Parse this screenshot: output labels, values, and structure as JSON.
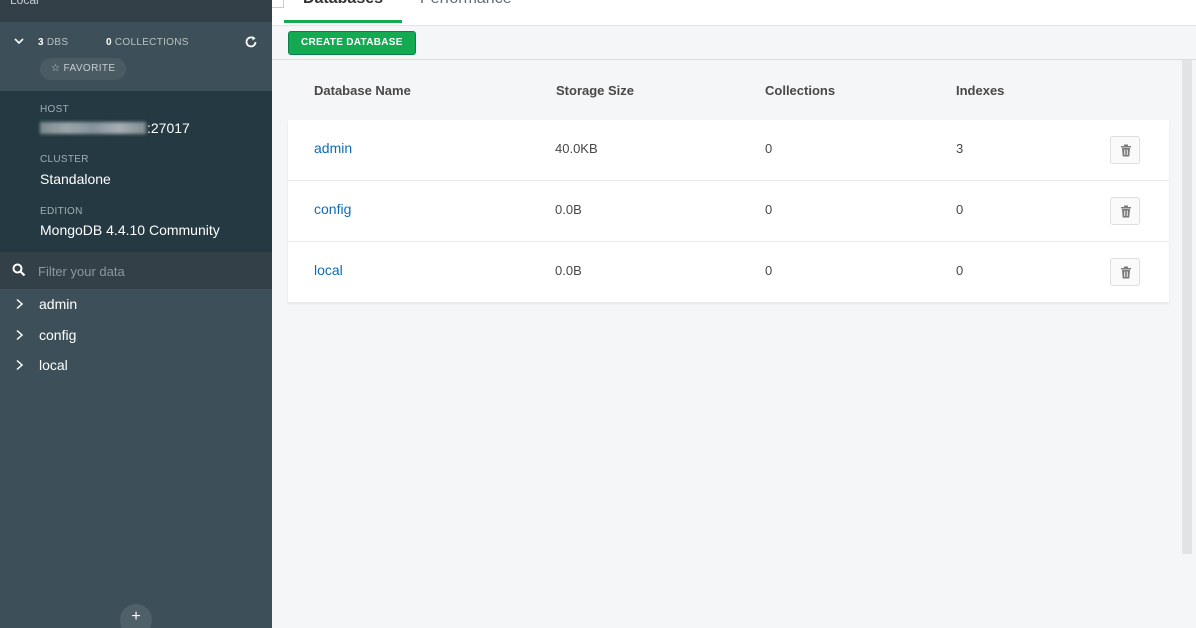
{
  "app": {
    "title": "Local"
  },
  "sidebar": {
    "stats": {
      "dbs_count": "3",
      "dbs_label": "DBS",
      "collections_count": "0",
      "collections_label": "COLLECTIONS"
    },
    "favorite_label": "☆ FAVORITE",
    "host_label": "HOST",
    "host_port": ":27017",
    "cluster_label": "CLUSTER",
    "cluster_value": "Standalone",
    "edition_label": "EDITION",
    "edition_value": "MongoDB 4.4.10 Community",
    "filter_placeholder": "Filter your data",
    "databases": [
      {
        "label": "admin"
      },
      {
        "label": "config"
      },
      {
        "label": "local"
      }
    ],
    "add_label": "+"
  },
  "tabs": [
    {
      "label": "Databases"
    },
    {
      "label": "Performance"
    }
  ],
  "toolbar": {
    "create_label": "CREATE DATABASE"
  },
  "table": {
    "columns": [
      "Database Name",
      "Storage Size",
      "Collections",
      "Indexes"
    ],
    "rows": [
      {
        "name": "admin",
        "storage": "40.0KB",
        "collections": "0",
        "indexes": "3"
      },
      {
        "name": "config",
        "storage": "0.0B",
        "collections": "0",
        "indexes": "0"
      },
      {
        "name": "local",
        "storage": "0.0B",
        "collections": "0",
        "indexes": "0"
      }
    ]
  },
  "colors": {
    "accent_green": "#13aa52",
    "link_blue": "#0d6cb6",
    "sidebar_bg": "#3d4f58",
    "sidebar_info_bg": "#243942"
  },
  "icons": {
    "chevron_down": "chevron-down-icon",
    "refresh": "refresh-icon",
    "search": "search-icon",
    "chevron_right": "chevron-right-icon",
    "trash": "trash-icon",
    "add": "plus-icon"
  }
}
